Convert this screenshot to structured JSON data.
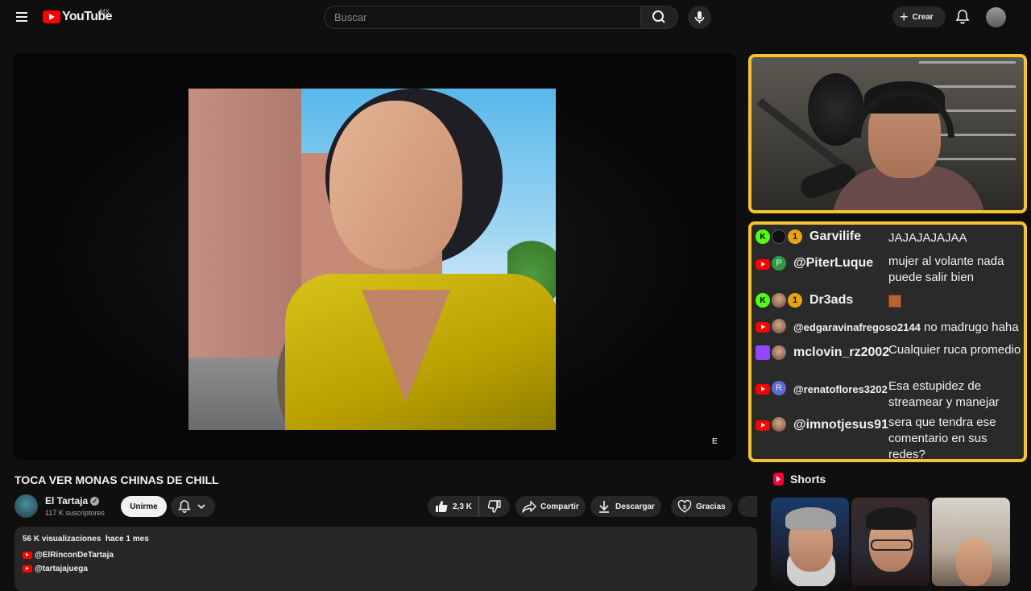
{
  "header": {
    "logo_text": "YouTube",
    "region": "MX",
    "search_placeholder": "Buscar",
    "create_label": "Crear"
  },
  "video": {
    "watermark": "E",
    "title": "TOCA VER MONAS CHINAS DE CHILL"
  },
  "channel": {
    "name": "El Tartaja",
    "subscribers": "117 K suscriptores",
    "join_label": "Unirme"
  },
  "actions": {
    "likes": "2,3 K",
    "share": "Compartir",
    "download": "Descargar",
    "thanks": "Gracias"
  },
  "description": {
    "views": "56 K visualizaciones",
    "date": "hace 1 mes",
    "links": [
      "@ElRinconDeTartaja",
      "@tartajajuega"
    ]
  },
  "chat": [
    {
      "platform": "kick",
      "badge": "1",
      "user": "Garvilife",
      "message": "JAJAJAJAJAA"
    },
    {
      "platform": "youtube",
      "avatar_letter": "P",
      "user": "@PiterLuque",
      "message": "mujer al volante nada puede salir bien"
    },
    {
      "platform": "kick",
      "badge": "1",
      "user": "Dr3ads",
      "message": ""
    },
    {
      "platform": "youtube",
      "user": "@edgaravinafregoso2144",
      "message": "no madrugo haha"
    },
    {
      "platform": "twitch",
      "user": "mclovin_rz2002",
      "message": "Cualquier ruca promedio"
    },
    {
      "platform": "youtube",
      "avatar_letter": "R",
      "user": "@renatoflores3202",
      "message": "Esa estupidez de streamear y manejar"
    },
    {
      "platform": "youtube",
      "user": "@imnotjesus91",
      "message": "sera que tendra ese comentario en sus redes?"
    }
  ],
  "shorts": {
    "heading": "Shorts"
  },
  "colors": {
    "accent": "#ff0000",
    "overlay_border": "#f5c234",
    "kick": "#53fc18",
    "twitch": "#9146ff"
  }
}
